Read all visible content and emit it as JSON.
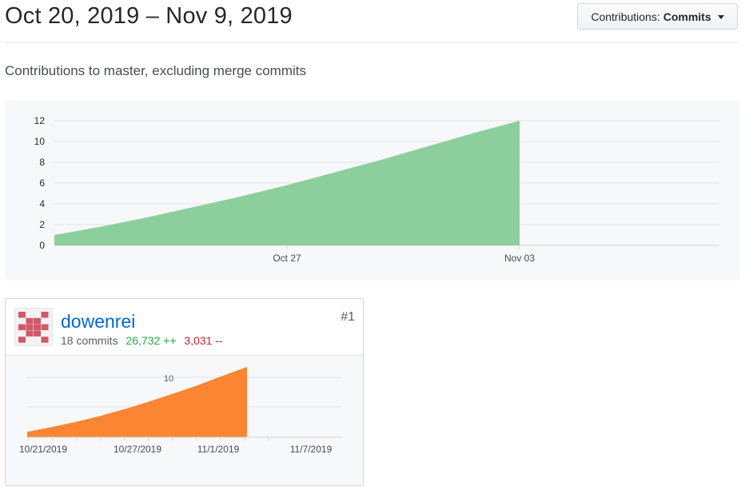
{
  "header": {
    "date_range": "Oct 20, 2019 – Nov 9, 2019",
    "contributions_prefix": "Contributions:",
    "contributions_value": "Commits"
  },
  "subtitle": "Contributions to master, excluding merge commits",
  "chart_data": [
    {
      "type": "area",
      "series": [
        {
          "values": [
            1,
            1.8,
            2.7,
            3.7,
            4.7,
            5.8,
            7.0,
            8.2,
            9.5,
            10.8,
            12
          ],
          "x": [
            "Oct 20",
            "Oct 21.5",
            "Oct 23",
            "Oct 24.5",
            "Oct 26",
            "Oct 27.5",
            "Oct 29",
            "Oct 30.5",
            "Nov 01",
            "Nov 02",
            "Nov 03"
          ]
        }
      ],
      "x_ticks": [
        "Oct 27",
        "Nov 03"
      ],
      "y_ticks": [
        0,
        2,
        4,
        6,
        8,
        10,
        12
      ],
      "ylim": [
        0,
        12
      ],
      "x_range": [
        "Oct 20, 2019",
        "Nov 9, 2019"
      ],
      "color": "#8ccf9c",
      "grid": true
    },
    {
      "type": "area",
      "series": [
        {
          "values": [
            1,
            1.9,
            2.9,
            4.0,
            5.3,
            6.7,
            8.2,
            9.8,
            11.5,
            13.2
          ],
          "x": [
            "10/19/2019",
            "10/21/2019",
            "10/23/2019",
            "10/25/2019",
            "10/27/2019",
            "10/29/2019",
            "10/31/2019",
            "11/1/2019",
            "11/2/2019",
            "11/3/2019"
          ]
        }
      ],
      "x_ticks": [
        "10/21/2019",
        "10/27/2019",
        "11/1/2019",
        "11/7/2019"
      ],
      "y_ticks": [
        10
      ],
      "color": "#fb8532",
      "grid": true
    }
  ],
  "contributor": {
    "name": "dowenrei",
    "commits": "18 commits",
    "additions": "26,732 ++",
    "deletions": "3,031 --",
    "rank": "#1"
  },
  "colors": {
    "link": "#0366d6",
    "additions": "#28a745",
    "deletions": "#cb2431",
    "avatar": "#d0596a"
  }
}
